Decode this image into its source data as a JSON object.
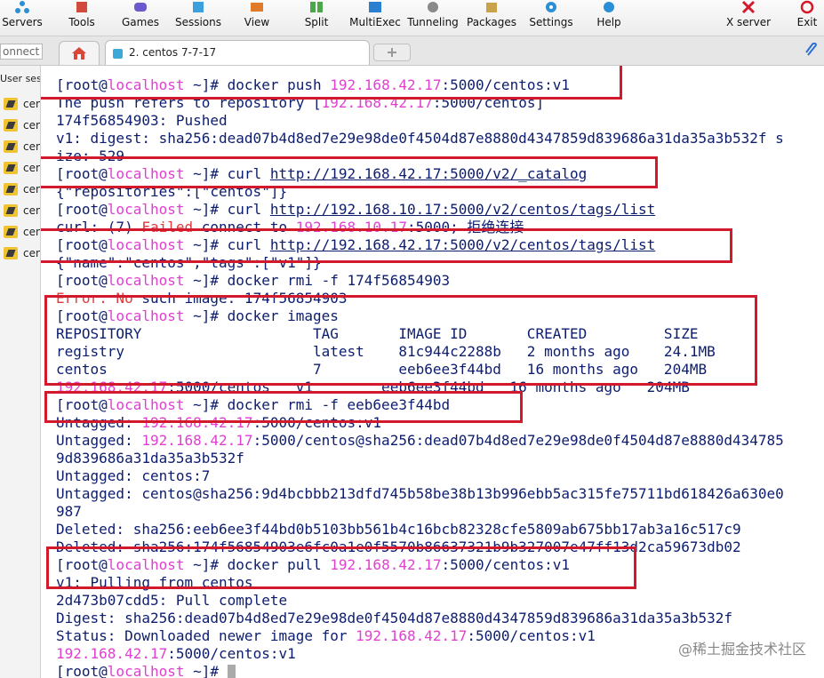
{
  "toolbar": {
    "items": [
      {
        "label": "Servers",
        "icon": "servers-icon"
      },
      {
        "label": "Tools",
        "icon": "tools-icon"
      },
      {
        "label": "Games",
        "icon": "games-icon"
      },
      {
        "label": "Sessions",
        "icon": "sessions-icon"
      },
      {
        "label": "View",
        "icon": "view-icon"
      },
      {
        "label": "Split",
        "icon": "split-icon"
      },
      {
        "label": "MultiExec",
        "icon": "multiexec-icon"
      },
      {
        "label": "Tunneling",
        "icon": "tunneling-icon"
      },
      {
        "label": "Packages",
        "icon": "packages-icon"
      },
      {
        "label": "Settings",
        "icon": "settings-icon"
      },
      {
        "label": "Help",
        "icon": "help-icon"
      },
      {
        "label": "X server",
        "icon": "xserver-icon"
      },
      {
        "label": "Exit",
        "icon": "exit-icon"
      }
    ]
  },
  "tabs": {
    "quick_connect": "onnect",
    "active_label": "2. centos 7-7-17"
  },
  "sidebar": {
    "header": "User ses",
    "items": [
      "cen",
      "cen",
      "cen",
      "cen",
      "cen",
      "cen",
      "cen",
      "cen"
    ]
  },
  "terminal": {
    "lines": [
      [
        {
          "t": "[root@"
        },
        {
          "t": "localhost",
          "c": "host"
        },
        {
          "t": " ~]# docker push "
        },
        {
          "t": "192.168.42.17",
          "c": "ip"
        },
        {
          "t": ":5000/centos:v1"
        }
      ],
      [
        {
          "t": "The push refers to repository ["
        },
        {
          "t": "192.168.42.17",
          "c": "ip"
        },
        {
          "t": ":5000/centos]"
        }
      ],
      [
        {
          "t": "174f56854903: Pushed"
        }
      ],
      [
        {
          "t": "v1: digest: sha256:dead07b4d8ed7e29e98de0f4504d87e8880d4347859d839686a31da35a3b532f s"
        }
      ],
      [
        {
          "t": "ize: 529"
        }
      ],
      [
        {
          "t": "[root@"
        },
        {
          "t": "localhost",
          "c": "host"
        },
        {
          "t": " ~]# curl "
        },
        {
          "t": "http://192.168.42.17:5000/v2/_catalog",
          "c": "ul"
        }
      ],
      [
        {
          "t": "{\"repositories\":[\"centos\"]}"
        }
      ],
      [
        {
          "t": "[root@"
        },
        {
          "t": "localhost",
          "c": "host"
        },
        {
          "t": " ~]# curl "
        },
        {
          "t": "http://192.168.10.17:5000/v2/centos/tags/list",
          "c": "ul"
        }
      ],
      [
        {
          "t": "curl: (7) "
        },
        {
          "t": "Failed",
          "c": "err"
        },
        {
          "t": " connect to "
        },
        {
          "t": "192.168.10.17",
          "c": "ip"
        },
        {
          "t": ":5000; 拒绝连接"
        }
      ],
      [
        {
          "t": "[root@"
        },
        {
          "t": "localhost",
          "c": "host"
        },
        {
          "t": " ~]# curl "
        },
        {
          "t": "http://192.168.42.17:5000/v2/centos/tags/list",
          "c": "ul"
        }
      ],
      [
        {
          "t": "{\"name\":\"centos\",\"tags\":[\"v1\"]}"
        }
      ],
      [
        {
          "t": "[root@"
        },
        {
          "t": "localhost",
          "c": "host"
        },
        {
          "t": " ~]# docker rmi -f 174f56854903"
        }
      ],
      [
        {
          "t": "Error: No",
          "c": "err"
        },
        {
          "t": " such image: 174f56854903"
        }
      ],
      [
        {
          "t": "[root@"
        },
        {
          "t": "localhost",
          "c": "host"
        },
        {
          "t": " ~]# docker images"
        }
      ],
      [
        {
          "t": "REPOSITORY                    TAG       IMAGE ID       CREATED         SIZE"
        }
      ],
      [
        {
          "t": "registry                      latest    81c944c2288b   2 months ago    24.1MB"
        }
      ],
      [
        {
          "t": "centos                        7         eeb6ee3f44bd   16 months ago   204MB"
        }
      ],
      [
        {
          "t": "192.168.42.17",
          "c": "ip"
        },
        {
          "t": ":5000/centos   v1        eeb6ee3f44bd   16 months ago   204MB"
        }
      ],
      [
        {
          "t": "[root@"
        },
        {
          "t": "localhost",
          "c": "host"
        },
        {
          "t": " ~]# docker rmi -f eeb6ee3f44bd"
        }
      ],
      [
        {
          "t": "Untagged: "
        },
        {
          "t": "192.168.42.17",
          "c": "ip"
        },
        {
          "t": ":5000/centos:v1"
        }
      ],
      [
        {
          "t": "Untagged: "
        },
        {
          "t": "192.168.42.17",
          "c": "ip"
        },
        {
          "t": ":5000/centos@sha256:dead07b4d8ed7e29e98de0f4504d87e8880d434785"
        }
      ],
      [
        {
          "t": "9d839686a31da35a3b532f"
        }
      ],
      [
        {
          "t": "Untagged: centos:7"
        }
      ],
      [
        {
          "t": "Untagged: centos@sha256:9d4bcbbb213dfd745b58be38b13b996ebb5ac315fe75711bd618426a630e0"
        }
      ],
      [
        {
          "t": "987"
        }
      ],
      [
        {
          "t": "Deleted: sha256:eeb6ee3f44bd0b5103bb561b4c16bcb82328cfe5809ab675bb17ab3a16c517c9"
        }
      ],
      [
        {
          "t": "Deleted: sha256:174f56854903e6fc0a1e0f5570b86637321b9b327007e47ff13d2ca59673db02"
        }
      ],
      [
        {
          "t": "[root@"
        },
        {
          "t": "localhost",
          "c": "host"
        },
        {
          "t": " ~]# docker pull "
        },
        {
          "t": "192.168.42.17",
          "c": "ip"
        },
        {
          "t": ":5000/centos:v1"
        }
      ],
      [
        {
          "t": "v1: Pulling from centos"
        }
      ],
      [
        {
          "t": "2d473b07cdd5: Pull complete"
        }
      ],
      [
        {
          "t": "Digest: sha256:dead07b4d8ed7e29e98de0f4504d87e8880d4347859d839686a31da35a3b532f"
        }
      ],
      [
        {
          "t": "Status: Downloaded newer image for "
        },
        {
          "t": "192.168.42.17",
          "c": "ip"
        },
        {
          "t": ":5000/centos:v1"
        }
      ],
      [
        {
          "t": "192.168.42.17",
          "c": "ip"
        },
        {
          "t": ":5000/centos:v1"
        }
      ],
      [
        {
          "t": "[root@"
        },
        {
          "t": "localhost",
          "c": "host"
        },
        {
          "t": " ~]# "
        }
      ]
    ]
  },
  "watermark": "@稀土掘金技术社区",
  "colors": {
    "terminal_text": "#0d1d6e",
    "hostname": "#e040d0",
    "error": "#e03a3a",
    "highlight_box": "#d21a2c"
  }
}
